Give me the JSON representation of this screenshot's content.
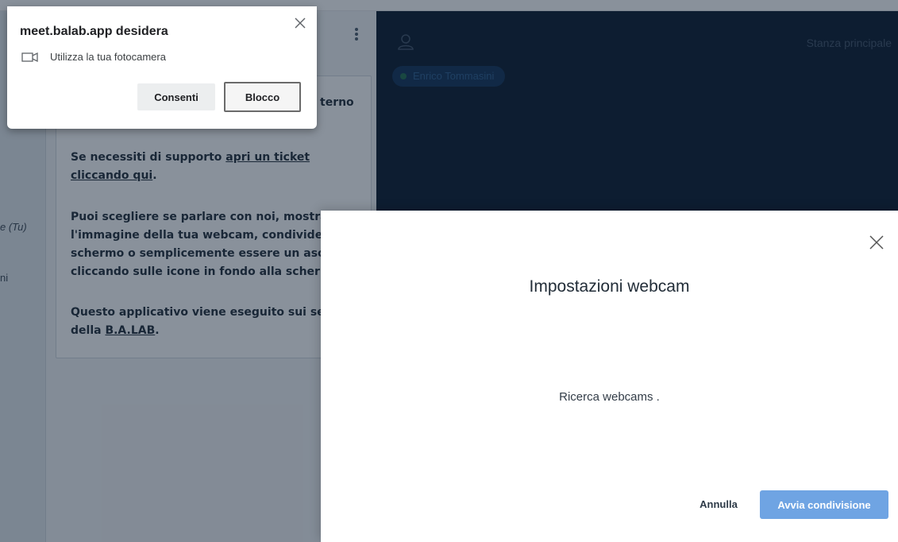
{
  "app": {
    "rail": {
      "self_label": "e (Tu)",
      "other_label": "ni"
    },
    "welcome": {
      "title_fragment": "terno",
      "support_prefix": "Se necessiti di supporto ",
      "support_link": "apri un ticket cliccando qui",
      "support_suffix": ".",
      "para_options": [
        "Puoi scegliere se parlare con noi, mostrare",
        "l'immagine della tua webcam, condividere",
        "schermo o semplicemente essere un ascolt",
        "cliccando sulle icone in fondo alla scherma"
      ],
      "server_line1": "Questo applicativo viene eseguito sui serve",
      "server_prefix": "della ",
      "server_link": "B.A.LAB",
      "server_suffix": "."
    },
    "room_title": "Stanza principale",
    "user_pill": "Enrico Tommasini"
  },
  "modal": {
    "title": "Impostazioni webcam",
    "status": "Ricerca webcams .",
    "cancel_label": "Annulla",
    "start_label": "Avvia condivisione"
  },
  "permission": {
    "title": "meet.balab.app desidera",
    "description": "Utilizza la tua fotocamera",
    "allow_label": "Consenti",
    "block_label": "Blocco"
  },
  "colors": {
    "accent": "#6fa4e3",
    "video_bg": "#06172a",
    "panel_bg": "#f2f4f6",
    "overlay": "rgba(20,35,55,0.5)"
  },
  "icons": {
    "user": "user-icon",
    "menu": "vertical-dots-icon",
    "modal_close": "close-icon",
    "perm_close": "close-icon",
    "camera": "camera-icon"
  }
}
